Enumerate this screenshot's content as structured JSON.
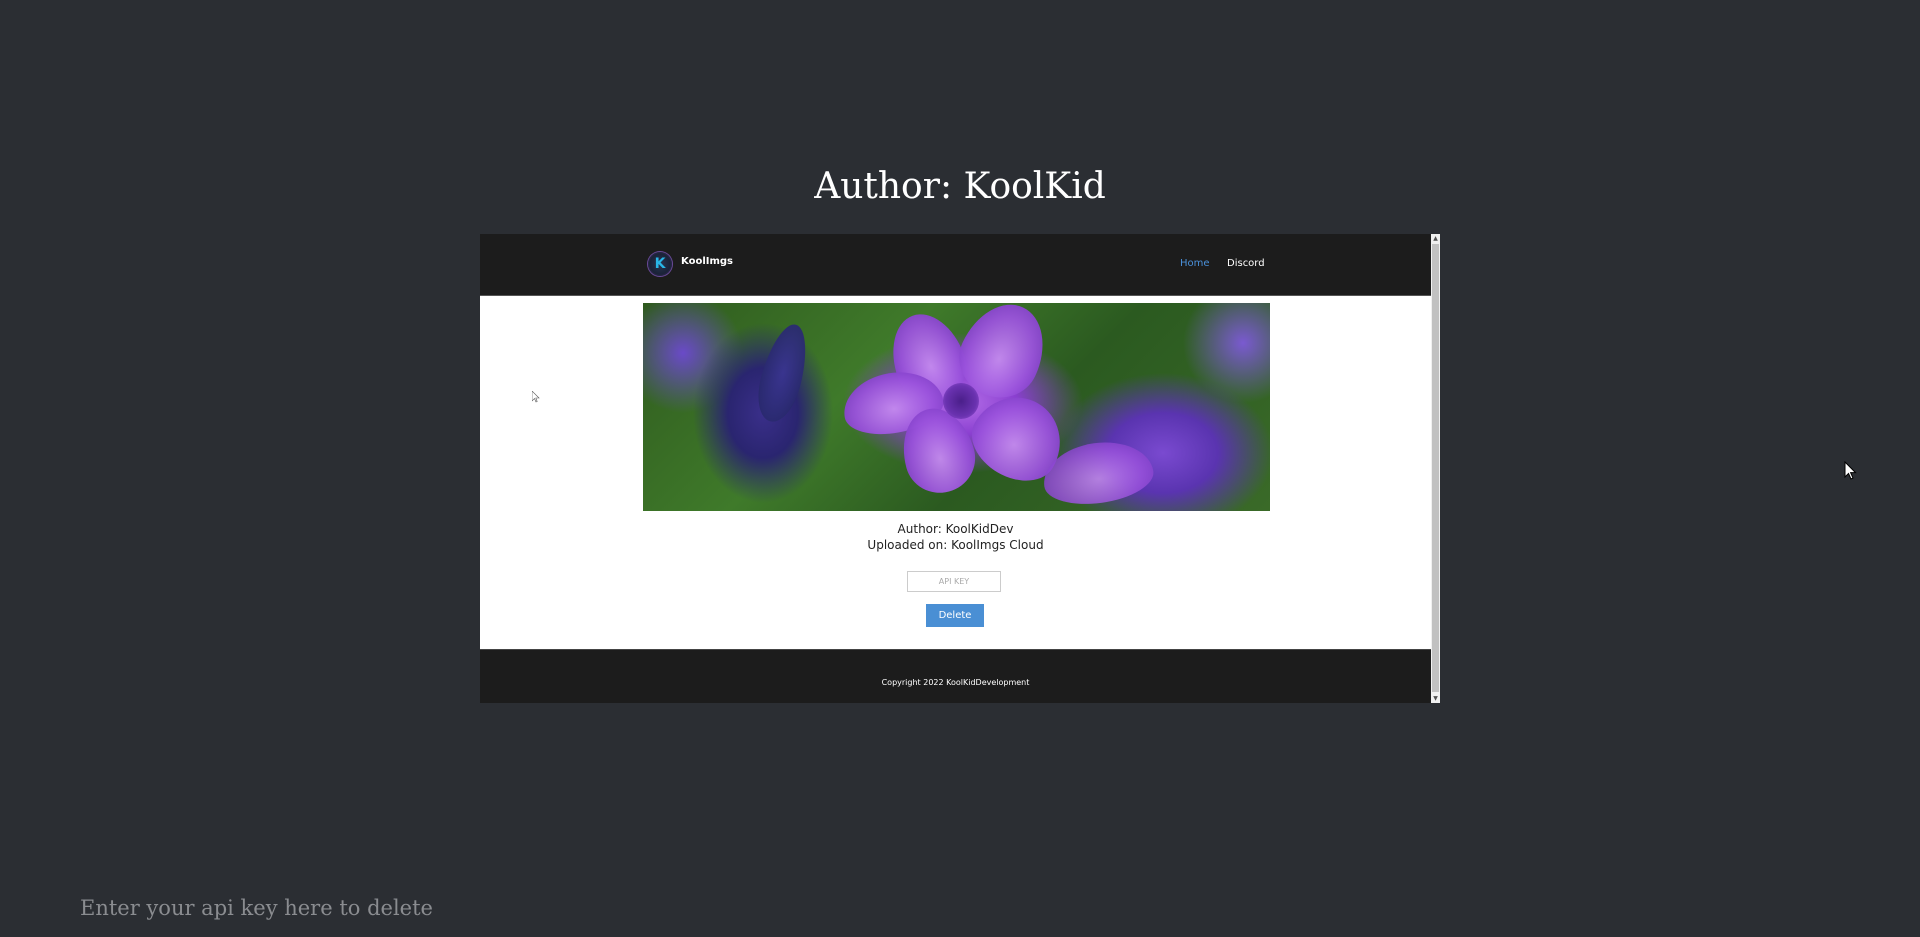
{
  "page": {
    "title": "Author: KoolKid",
    "api_key_placeholder": "Enter your api key here to delete"
  },
  "embedded_site": {
    "brand": "KoolImgs",
    "logo_letter": "K",
    "nav": {
      "home": "Home",
      "discord": "Discord"
    },
    "author_line": "Author: KoolKidDev",
    "uploaded_line": "Uploaded on: KoolImgs Cloud",
    "api_key_input_placeholder": "API KEY",
    "delete_button": "Delete",
    "copyright": "Copyright 2022 KoolKidDevelopment"
  },
  "colors": {
    "page_background": "#2b2e33",
    "header_background": "#1c1c1c",
    "nav_active": "#4a90d9",
    "delete_button": "#4a8fd4"
  },
  "icons": {
    "logo": "koolimgs-logo-icon",
    "scroll_up": "scroll-up-arrow-icon",
    "scroll_down": "scroll-down-arrow-icon",
    "cursor": "mouse-pointer-icon"
  }
}
